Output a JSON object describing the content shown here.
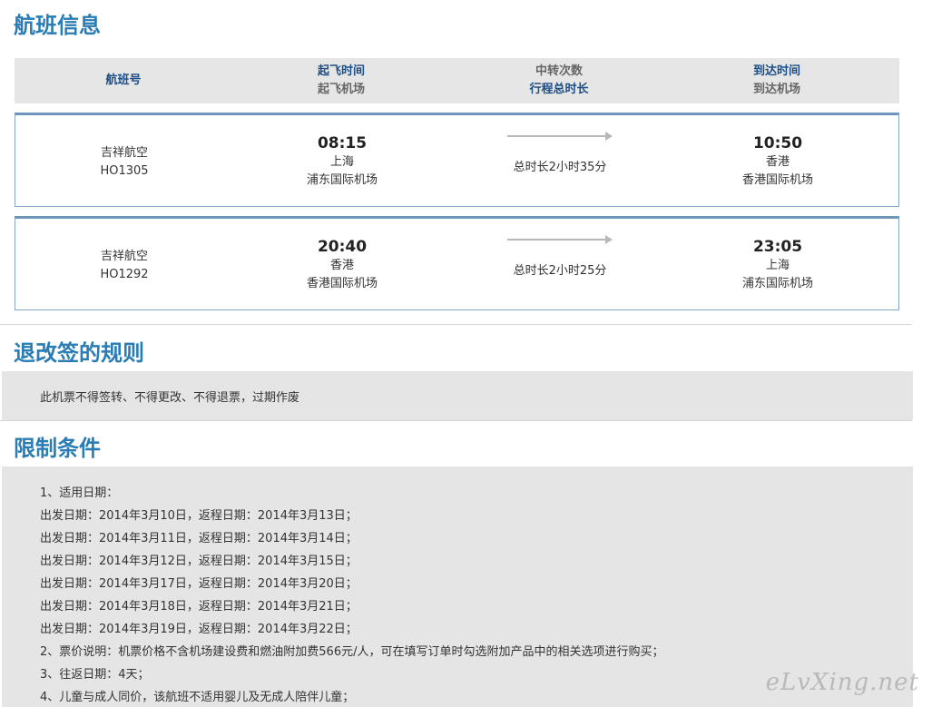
{
  "sections": {
    "flight_info": "航班信息",
    "refund_rules": "退改签的规则",
    "restrictions": "限制条件"
  },
  "header": {
    "flight_no": "航班号",
    "dep_time": "起飞时间",
    "dep_airport": "起飞机场",
    "transfers": "中转次数",
    "total_duration": "行程总时长",
    "arr_time": "到达时间",
    "arr_airport": "到达机场"
  },
  "flights": [
    {
      "airline": "吉祥航空",
      "flight_no": "HO1305",
      "dep_time": "08:15",
      "dep_city": "上海",
      "dep_airport": "浦东国际机场",
      "duration": "总时长2小时35分",
      "arr_time": "10:50",
      "arr_city": "香港",
      "arr_airport": "香港国际机场"
    },
    {
      "airline": "吉祥航空",
      "flight_no": "HO1292",
      "dep_time": "20:40",
      "dep_city": "香港",
      "dep_airport": "香港国际机场",
      "duration": "总时长2小时25分",
      "arr_time": "23:05",
      "arr_city": "上海",
      "arr_airport": "浦东国际机场"
    }
  ],
  "refund_text": "此机票不得签转、不得更改、不得退票，过期作废",
  "restrictions": [
    "1、适用日期：",
    "出发日期：2014年3月10日，返程日期：2014年3月13日；",
    "出发日期：2014年3月11日，返程日期：2014年3月14日；",
    "出发日期：2014年3月12日，返程日期：2014年3月15日；",
    "出发日期：2014年3月17日，返程日期：2014年3月20日；",
    "出发日期：2014年3月18日，返程日期：2014年3月21日；",
    "出发日期：2014年3月19日，返程日期：2014年3月22日；",
    "2、票价说明：机票价格不含机场建设费和燃油附加费566元/人，可在填写订单时勾选附加产品中的相关选项进行购买；",
    "3、往返日期：4天；",
    "4、儿童与成人同价，该航班不适用婴儿及无成人陪伴儿童；"
  ],
  "watermark": "eLvXing.net"
}
